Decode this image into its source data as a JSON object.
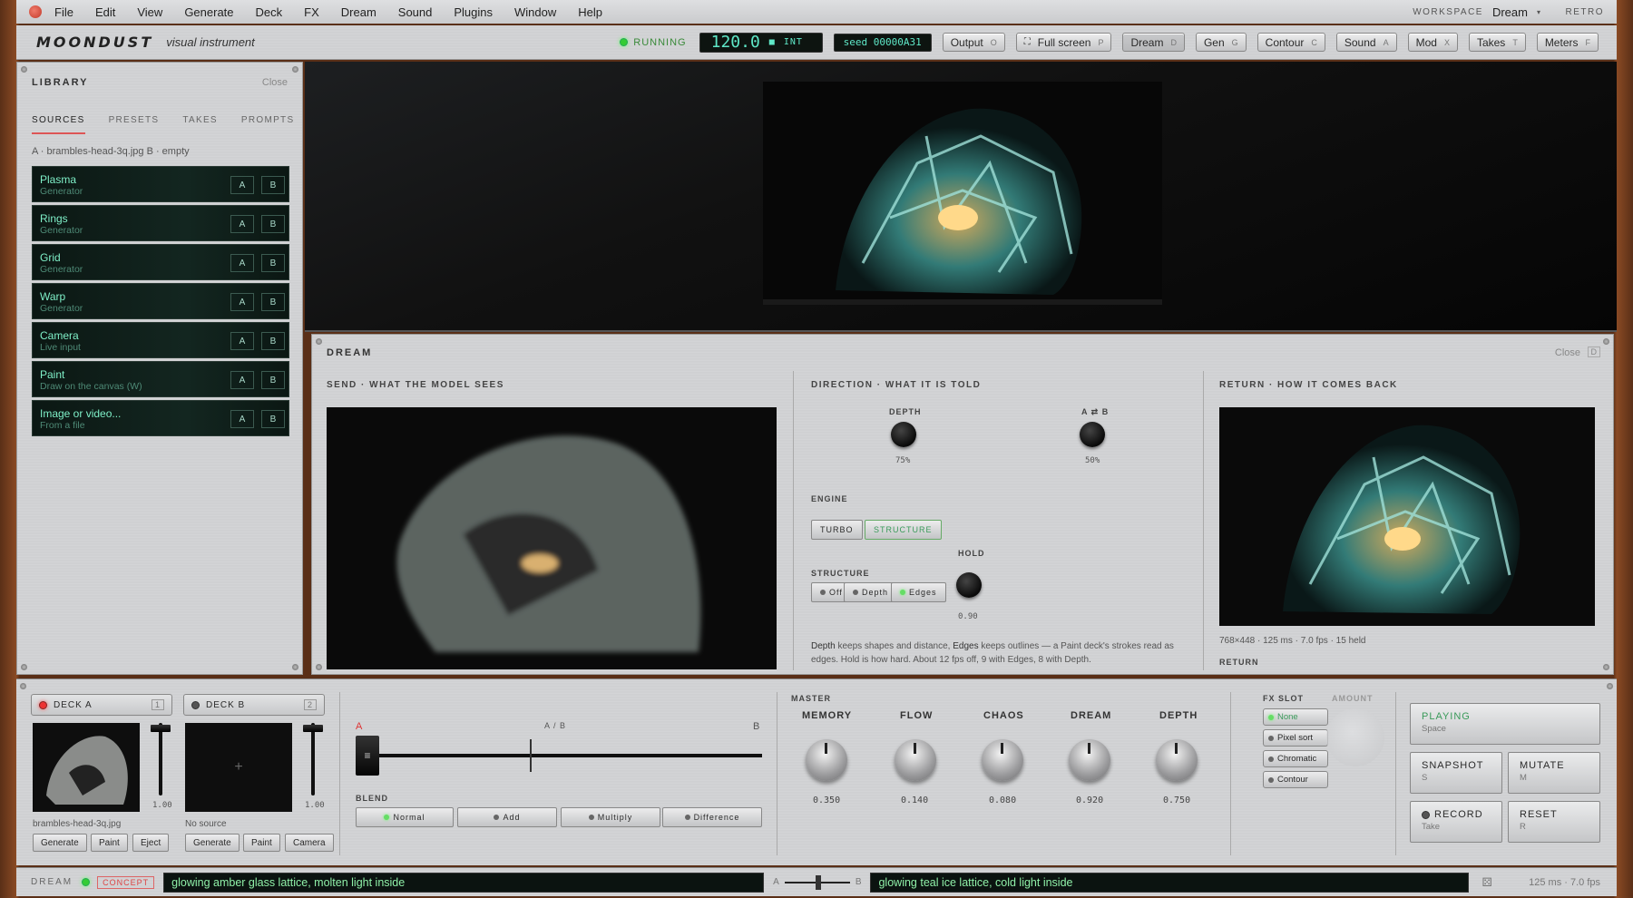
{
  "menu": {
    "items": [
      "File",
      "Edit",
      "View",
      "Generate",
      "Deck",
      "FX",
      "Dream",
      "Sound",
      "Plugins",
      "Window",
      "Help"
    ],
    "workspace_label": "WORKSPACE",
    "workspace_value": "Dream",
    "retro_label": "RETRO"
  },
  "toolbar": {
    "brand": "MOONDUST",
    "subtitle": "visual instrument",
    "status": "RUNNING",
    "bpm": "120.0",
    "clock_mode": "INT",
    "seed": "seed 00000A31",
    "buttons": [
      {
        "label": "Output",
        "key": "O"
      },
      {
        "label": "Full screen",
        "key": "P"
      },
      {
        "label": "Dream",
        "key": "D"
      },
      {
        "label": "Gen",
        "key": "G"
      },
      {
        "label": "Contour",
        "key": "C"
      },
      {
        "label": "Sound",
        "key": "A"
      },
      {
        "label": "Mod",
        "key": "X"
      },
      {
        "label": "Takes",
        "key": "T"
      },
      {
        "label": "Meters",
        "key": "F"
      }
    ]
  },
  "library": {
    "title": "LIBRARY",
    "close": "Close",
    "tabs": [
      "SOURCES",
      "PRESETS",
      "TAKES",
      "PROMPTS"
    ],
    "loaded": "A · brambles-head-3q.jpg   B · empty",
    "sources": [
      {
        "name": "Plasma",
        "type": "Generator"
      },
      {
        "name": "Rings",
        "type": "Generator"
      },
      {
        "name": "Grid",
        "type": "Generator"
      },
      {
        "name": "Warp",
        "type": "Generator"
      },
      {
        "name": "Camera",
        "type": "Live input"
      },
      {
        "name": "Paint",
        "type": "Draw on the canvas (W)"
      },
      {
        "name": "Image or video...",
        "type": "From a file"
      }
    ],
    "a_label": "A",
    "b_label": "B"
  },
  "dream": {
    "title": "DREAM",
    "close": "Close",
    "close_key": "D",
    "send_header": "SEND · WHAT THE MODEL SEES",
    "direction_header": "DIRECTION · WHAT IT IS TOLD",
    "return_header": "RETURN · HOW IT COMES BACK",
    "depth_label": "DEPTH",
    "depth_value": "75%",
    "ab_label": "A ⇄ B",
    "ab_value": "50%",
    "engine_label": "ENGINE",
    "engine_turbo": "TURBO",
    "engine_structure": "STRUCTURE",
    "structure_label": "STRUCTURE",
    "structure_options": [
      "Off",
      "Depth",
      "Edges"
    ],
    "hold_label": "HOLD",
    "hold_value": "0.90",
    "note_depth": "Depth",
    "note_part1": " keeps shapes and distance, ",
    "note_edges": "Edges",
    "note_part2": " keeps outlines — a Paint deck's strokes read as edges. Hold is how hard. About 12 fps off, 9 with Edges, 8 with Depth.",
    "return_info": "768×448 · 125 ms · 7.0 fps · 15 held",
    "return_sub": "RETURN"
  },
  "deck_a": {
    "label": "DECK A",
    "num": "1",
    "file": "brambles-head-3q.jpg",
    "fader": "1.00",
    "buttons": [
      "Generate",
      "Paint",
      "Eject"
    ]
  },
  "deck_b": {
    "label": "DECK B",
    "num": "2",
    "file": "No source",
    "fader": "1.00",
    "buttons": [
      "Generate",
      "Paint",
      "Camera"
    ]
  },
  "crossfader": {
    "a": "A",
    "b": "B",
    "center": "A / B",
    "blend_label": "BLEND",
    "blend_modes": [
      "Normal",
      "Add",
      "Multiply",
      "Difference"
    ],
    "position": 0.44
  },
  "master": {
    "label": "MASTER",
    "knobs": [
      {
        "label": "MEMORY",
        "value": "0.350"
      },
      {
        "label": "FLOW",
        "value": "0.140"
      },
      {
        "label": "CHAOS",
        "value": "0.080"
      },
      {
        "label": "DREAM",
        "value": "0.920"
      },
      {
        "label": "DEPTH",
        "value": "0.750"
      }
    ]
  },
  "fx": {
    "label": "FX SLOT",
    "amount": "AMOUNT",
    "slots": [
      "None",
      "Pixel sort",
      "Chromatic",
      "Contour"
    ]
  },
  "transport": {
    "playing": "PLAYING",
    "playing_key": "Space",
    "snapshot": "SNAPSHOT",
    "snapshot_key": "S",
    "mutate": "MUTATE",
    "mutate_key": "M",
    "record": "RECORD",
    "record_key": "Take",
    "reset": "RESET",
    "reset_key": "R"
  },
  "status": {
    "mode": "DREAM",
    "concept": "CONCEPT",
    "prompt_a": "glowing amber glass lattice, molten light inside",
    "a": "A",
    "b": "B",
    "prompt_b": "glowing teal ice lattice, cold light inside",
    "timing": "125 ms · 7.0 fps"
  }
}
